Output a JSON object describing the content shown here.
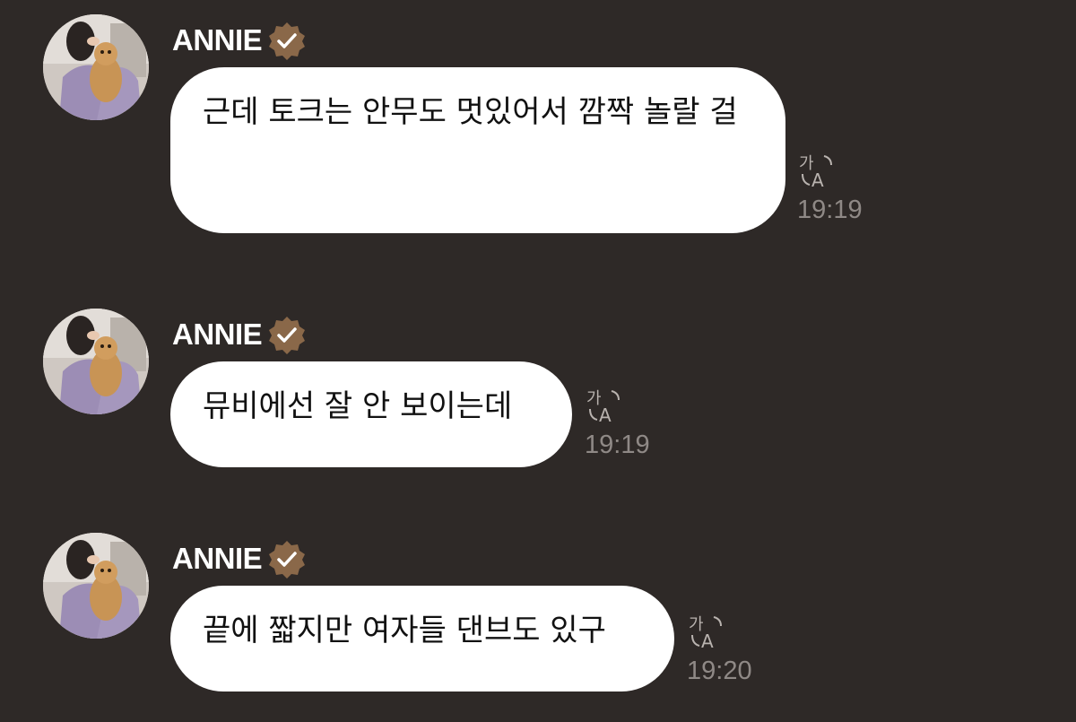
{
  "messages": [
    {
      "sender": "ANNIE",
      "text": "근데 토크는 안무도 멋있어서 깜짝 놀랄 걸",
      "time": "19:19"
    },
    {
      "sender": "ANNIE",
      "text": "뮤비에선 잘 안 보이는데",
      "time": "19:19"
    },
    {
      "sender": "ANNIE",
      "text": "끝에 짧지만 여자들 댄브도 있구",
      "time": "19:20"
    }
  ],
  "icons": {
    "verified": "verified-badge-icon",
    "translate": "translate-icon"
  },
  "colors": {
    "background": "#2e2927",
    "bubble": "#ffffff",
    "verified_badge": "#8a6849",
    "timestamp": "#8f8986"
  }
}
